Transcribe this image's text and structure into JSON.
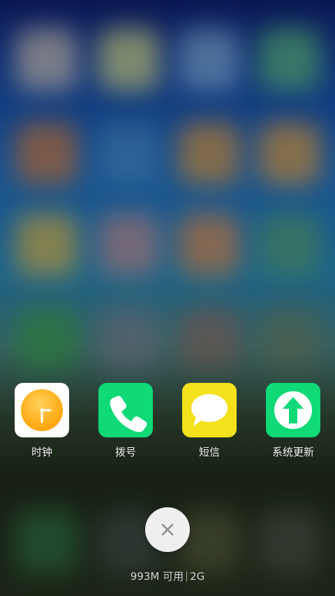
{
  "recent_apps": [
    {
      "label": "时钟",
      "icon": "clock-icon",
      "bg": "#ffffff",
      "accent": "#ffb21a"
    },
    {
      "label": "拨号",
      "icon": "phone-icon",
      "bg": "#10d977",
      "accent": "#ffffff"
    },
    {
      "label": "短信",
      "icon": "message-bubble-icon",
      "bg": "#f3e21b",
      "accent": "#ffffff"
    },
    {
      "label": "系统更新",
      "icon": "up-arrow-icon",
      "bg": "#10d977",
      "accent": "#ffffff"
    }
  ],
  "close": {
    "icon": "close-icon"
  },
  "memory": {
    "available_text": "993M 可用",
    "total_text": "2G"
  }
}
